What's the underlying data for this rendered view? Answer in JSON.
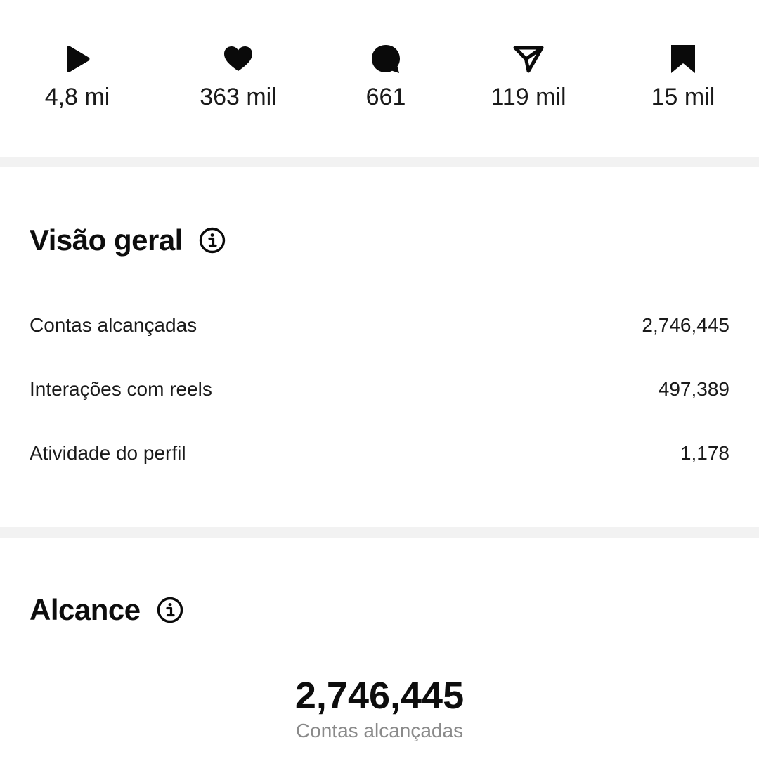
{
  "stats": [
    {
      "icon": "play-icon",
      "value": "4,8 mi"
    },
    {
      "icon": "heart-icon",
      "value": "363 mil"
    },
    {
      "icon": "comment-icon",
      "value": "661"
    },
    {
      "icon": "share-icon",
      "value": "119 mil"
    },
    {
      "icon": "bookmark-icon",
      "value": "15 mil"
    }
  ],
  "overview": {
    "title": "Visão geral",
    "rows": [
      {
        "label": "Contas alcançadas",
        "value": "2,746,445"
      },
      {
        "label": "Interações com reels",
        "value": "497,389"
      },
      {
        "label": "Atividade do perfil",
        "value": "1,178"
      }
    ]
  },
  "reach": {
    "title": "Alcance",
    "total": "2,746,445",
    "caption": "Contas alcançadas"
  },
  "colors": {
    "text": "#111111",
    "muted": "#8a8a8a",
    "separator": "#f2f2f2"
  }
}
